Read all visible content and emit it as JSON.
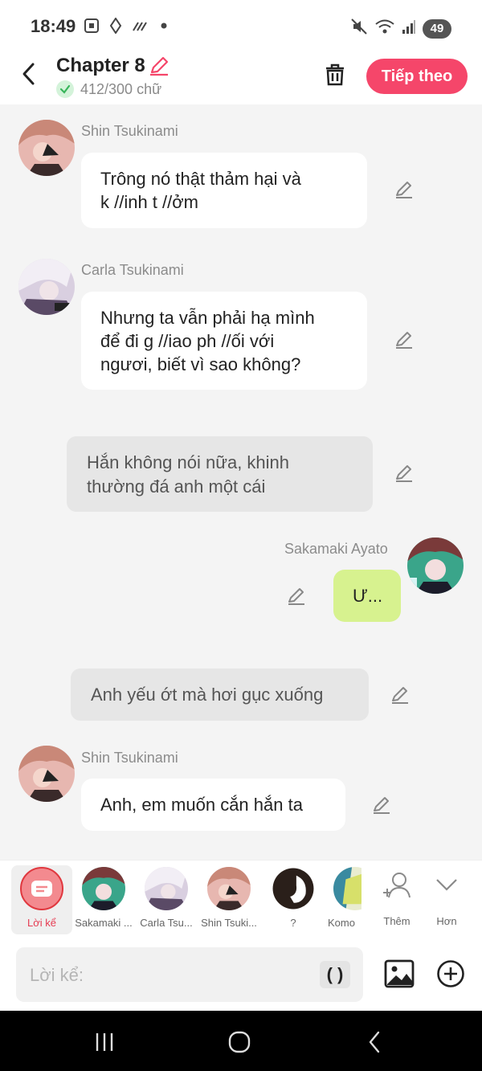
{
  "status": {
    "time": "18:49",
    "battery": "49"
  },
  "header": {
    "title": "Chapter 8",
    "word_count": "412/300 chữ",
    "next_label": "Tiếp theo"
  },
  "messages": [
    {
      "speaker": "Shin Tsukinami",
      "line1": "Trông nó thật thảm hại và",
      "line2": "k //inh t //ởm"
    },
    {
      "speaker": "Carla Tsukinami",
      "line1": "Nhưng ta vẫn phải hạ mình",
      "line2": "để đi g //iao ph //ối với",
      "line3": "ngươi, biết vì sao không?"
    },
    {
      "narration_line1": "Hắn không nói nữa, khinh",
      "narration_line2": "thường đá anh một cái"
    },
    {
      "speaker": "Sakamaki Ayato",
      "text": "Ư..."
    },
    {
      "narration": "Anh yếu ớt mà hơi gục xuống"
    },
    {
      "speaker": "Shin Tsukinami",
      "text": "Anh, em muốn cắn hắn ta"
    }
  ],
  "characters": [
    {
      "label": "Lời kể"
    },
    {
      "label": "Sakamaki ..."
    },
    {
      "label": "Carla Tsu..."
    },
    {
      "label": "Shin Tsuki..."
    },
    {
      "label": "?"
    },
    {
      "label": "Komo"
    },
    {
      "label": "Thêm"
    },
    {
      "label": "Hơn"
    }
  ],
  "input": {
    "placeholder": "Lời kể:",
    "paren": "( )"
  },
  "colors": {
    "accent": "#f5466a",
    "narration_bg": "#e6e6e6",
    "my_bubble": "#d7f28f",
    "background": "#f4f4f4"
  }
}
